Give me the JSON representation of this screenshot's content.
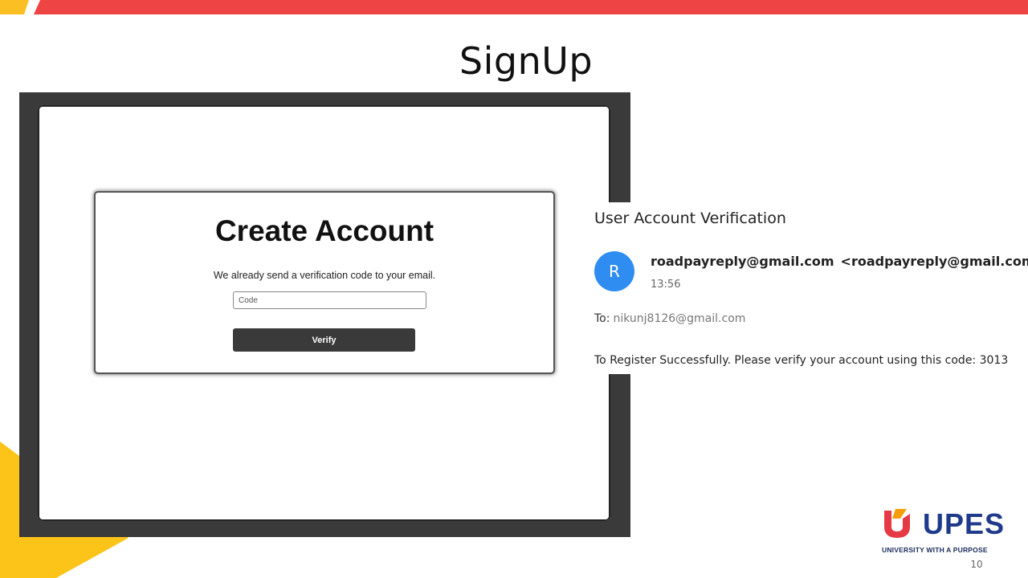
{
  "slide": {
    "title": "SignUp",
    "page_number": "10",
    "colors": {
      "top_bar_red": "#ef4444",
      "top_bar_yellow": "#fbbf24",
      "corner_yellow": "#fcc419",
      "frame_dark": "#3a3a3a"
    }
  },
  "signup_form": {
    "heading": "Create Account",
    "message": "We already send a verification code to your email.",
    "code_input": {
      "value": "",
      "placeholder": "Code"
    },
    "verify_label": "Verify"
  },
  "email": {
    "subject": "User Account Verification",
    "avatar_letter": "R",
    "avatar_color": "#2f8cf0",
    "sender_name": "roadpayreply@gmail.com",
    "sender_address": "<roadpayreply@gmail.com>",
    "time": "13:56",
    "to_label": "To:",
    "to_address": "nikunj8126@gmail.com",
    "body": "To Register Successfully. Please verify your account using this code: 3013"
  },
  "logo": {
    "wordmark": "UPES",
    "tagline": "UNIVERSITY WITH A PURPOSE",
    "mark_icon": "upes-shield-icon",
    "brand_blue": "#1f3a8a",
    "brand_red": "#e63946",
    "brand_orange": "#f59e0b"
  }
}
